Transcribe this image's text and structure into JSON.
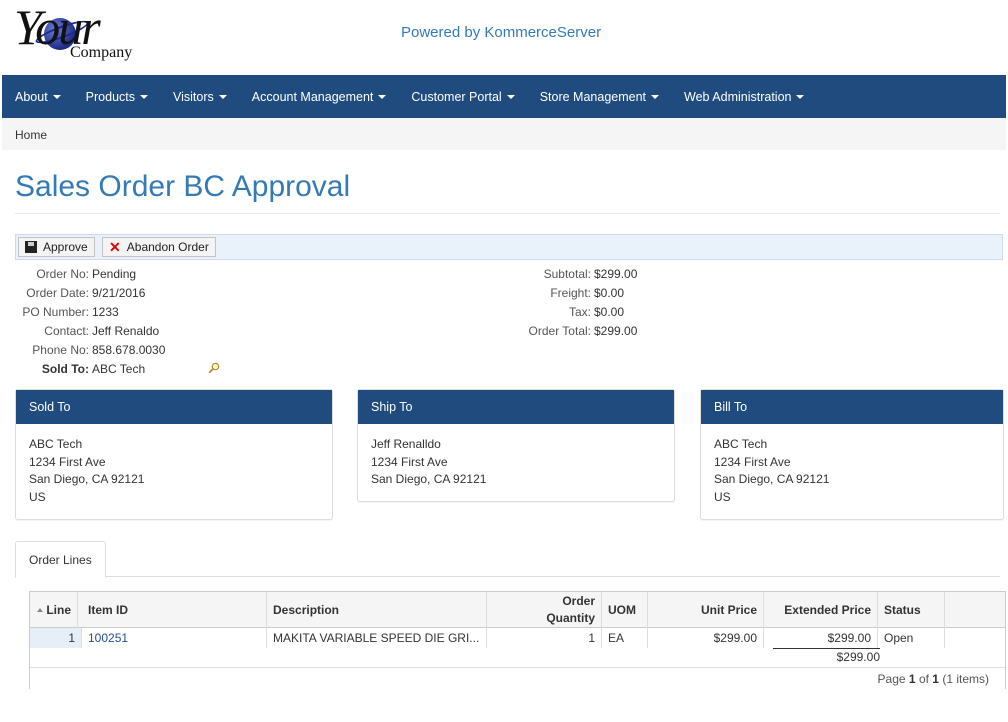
{
  "logo": {
    "text_big": "Your",
    "text_small": "Company"
  },
  "header": {
    "powered_by": "Powered by KommerceServer"
  },
  "nav": {
    "items": [
      {
        "label": "About"
      },
      {
        "label": "Products"
      },
      {
        "label": "Visitors"
      },
      {
        "label": "Account Management"
      },
      {
        "label": "Customer Portal"
      },
      {
        "label": "Store Management"
      },
      {
        "label": "Web Administration"
      }
    ]
  },
  "breadcrumb": {
    "home": "Home"
  },
  "page": {
    "title": "Sales Order BC Approval"
  },
  "toolbar": {
    "approve_label": "Approve",
    "abandon_label": "Abandon Order"
  },
  "order_info": {
    "order_no_label": "Order No:",
    "order_no": "Pending",
    "order_date_label": "Order Date:",
    "order_date": "9/21/2016",
    "po_label": "PO Number:",
    "po_number": "1233",
    "contact_label": "Contact:",
    "contact": "Jeff Renaldo",
    "phone_label": "Phone No:",
    "phone": "858.678.0030",
    "sold_to_label": "Sold To:",
    "sold_to": "ABC Tech"
  },
  "totals": {
    "subtotal_label": "Subtotal:",
    "subtotal": "$299.00",
    "freight_label": "Freight:",
    "freight": "$0.00",
    "tax_label": "Tax:",
    "tax": "$0.00",
    "order_total_label": "Order Total:",
    "order_total": "$299.00"
  },
  "addresses": {
    "sold_to": {
      "title": "Sold To",
      "line1": "ABC Tech",
      "line2": "1234 First Ave",
      "line3": "San Diego, CA 92121",
      "line4": "US"
    },
    "ship_to": {
      "title": "Ship To",
      "line1": "Jeff Renalldo",
      "line2": "1234 First Ave",
      "line3": "San Diego, CA 92121"
    },
    "bill_to": {
      "title": "Bill To",
      "line1": "ABC Tech",
      "line2": "1234 First Ave",
      "line3": "San Diego, CA 92121",
      "line4": "US"
    }
  },
  "tabs": {
    "order_lines": "Order Lines"
  },
  "grid": {
    "headers": {
      "line": "Line",
      "item_id": "Item ID",
      "description": "Description",
      "order_qty_1": "Order",
      "order_qty_2": "Quantity",
      "uom": "UOM",
      "unit_price": "Unit Price",
      "extended_price": "Extended Price",
      "status": "Status"
    },
    "rows": [
      {
        "line": "1",
        "item_id": "100251",
        "description": "MAKITA VARIABLE SPEED DIE GRI...",
        "qty": "1",
        "uom": "EA",
        "unit_price": "$299.00",
        "extended_price": "$299.00",
        "status": "Open"
      }
    ],
    "extended_total": "$299.00",
    "pager": {
      "prefix": "Page",
      "page": "1",
      "of": "of",
      "total_pages": "1",
      "items": "(1 items)"
    }
  }
}
